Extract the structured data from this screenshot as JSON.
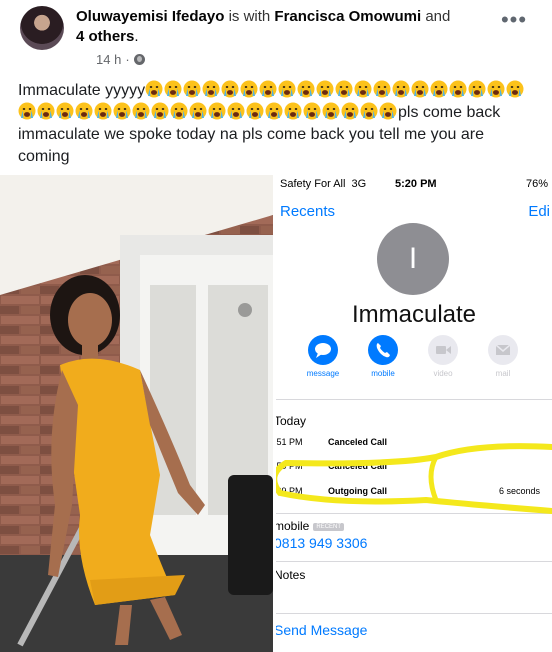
{
  "post": {
    "author": "Oluwayemisi Ifedayo",
    "with_text": "is with",
    "tagged": "Francisca Omowumi",
    "and_text": "and",
    "others": "4 others",
    "others_period": ".",
    "time": "14 h",
    "dot": "·",
    "more": "•••",
    "text_start": "Immaculate yyyyy",
    "text_end": "pls come back immaculate we spoke today na pls come back you tell me you are coming",
    "emoji_count_line1": 19,
    "emoji_count_line2": 21,
    "emoji_name": "loudly-crying-face"
  },
  "screenshot": {
    "carrier": "Safety For All",
    "network": "3G",
    "time": "5:20 PM",
    "battery": "76%",
    "back_label": "Recents",
    "edit_label": "Edi",
    "avatar_initial": "I",
    "contact_name": "Immaculate",
    "actions": [
      {
        "label": "message",
        "icon": "message-icon",
        "enabled": true
      },
      {
        "label": "mobile",
        "icon": "phone-icon",
        "enabled": true
      },
      {
        "label": "video",
        "icon": "video-icon",
        "enabled": false
      },
      {
        "label": "mail",
        "icon": "mail-icon",
        "enabled": false
      }
    ],
    "day_label": "Today",
    "calls": [
      {
        "time": ":51 PM",
        "kind": "Canceled Call",
        "duration": ""
      },
      {
        "time": ":50 PM",
        "kind": "Canceled Call",
        "duration": ""
      },
      {
        "time": ":39 PM",
        "kind": "Outgoing Call",
        "duration": "6 seconds"
      }
    ],
    "mobile_label": "mobile",
    "recent_badge": "RECENT",
    "phone_number": "0813 949 3306",
    "notes_label": "Notes",
    "send_message": "Send Message"
  },
  "colors": {
    "ios_blue": "#007aff",
    "highlight": "#f4e81c",
    "dress": "#f1ac1c"
  }
}
